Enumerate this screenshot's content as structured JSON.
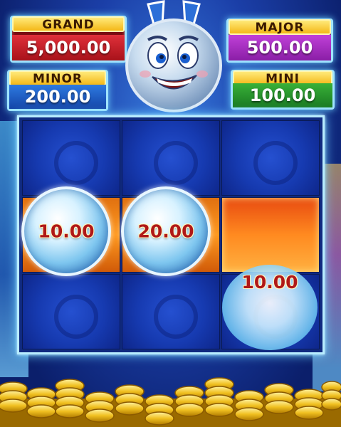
{
  "jackpots": {
    "grand": {
      "label": "GRAND",
      "value": "5,000.00"
    },
    "minor": {
      "label": "MINOR",
      "value": "200.00"
    },
    "major": {
      "label": "MAJOR",
      "value": "500.00"
    },
    "mini": {
      "label": "MINI",
      "value": "100.00"
    }
  },
  "reels": {
    "coin_row2_col1": "10.00",
    "coin_row2_col2": "20.00",
    "coin_row3_col3": "10.00"
  },
  "colors": {
    "grand": "#d02530",
    "minor": "#2466d0",
    "major": "#b035cc",
    "mini": "#2c9a2c",
    "frame_glow": "#6fd6ff",
    "coin_value": "#b01818"
  },
  "icons": [
    "mascot-coin-icon",
    "gold-coin-pile-icon",
    "lightning-icon"
  ]
}
